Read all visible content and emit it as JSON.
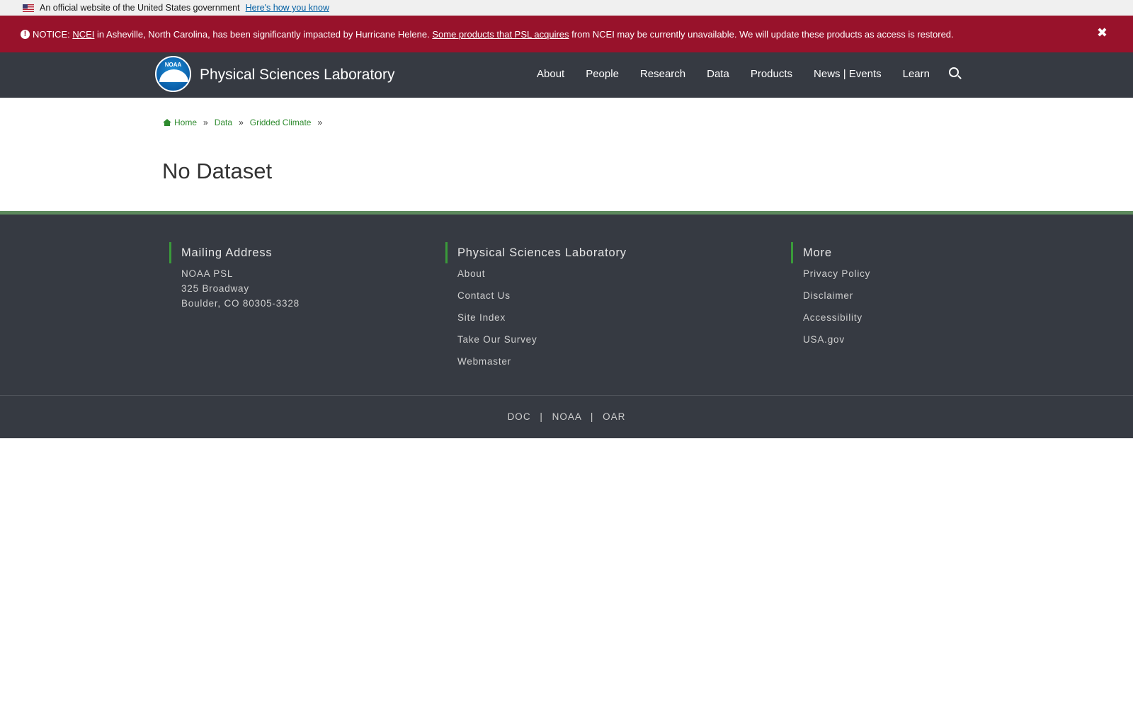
{
  "gov_banner": {
    "text": "An official website of the United States government",
    "link": "Here's how you know"
  },
  "notice": {
    "label": "NOTICE:",
    "ncei_link": "NCEI",
    "text1": " in Asheville, North Carolina, has been significantly impacted by Hurricane Helene. ",
    "products_link": "Some products that PSL acquires",
    "text2": " from NCEI may be currently unavailable. We will update these products as access is restored.",
    "close_glyph": "✖"
  },
  "header": {
    "logo_text": "NOAA",
    "site_title": "Physical Sciences Laboratory",
    "nav": [
      "About",
      "People",
      "Research",
      "Data",
      "Products",
      "News | Events",
      "Learn"
    ]
  },
  "breadcrumb": {
    "items": [
      "Home",
      "Data",
      "Gridded Climate"
    ],
    "separator": "»"
  },
  "page": {
    "title": "No Dataset"
  },
  "footer": {
    "mailing": {
      "heading": "Mailing Address",
      "lines": [
        "NOAA PSL",
        "325 Broadway",
        "Boulder, CO 80305-3328"
      ]
    },
    "psl": {
      "heading": "Physical Sciences Laboratory",
      "links": [
        "About",
        "Contact Us",
        "Site Index",
        "Take Our Survey",
        "Webmaster"
      ]
    },
    "more": {
      "heading": "More",
      "links": [
        "Privacy Policy",
        "Disclaimer",
        "Accessibility",
        "USA.gov"
      ]
    },
    "bottom_links": [
      "DOC",
      "NOAA",
      "OAR"
    ],
    "bottom_separator": "|"
  },
  "colors": {
    "notice_bg": "#98122b",
    "header_bg": "#363a42",
    "accent_green": "#2e8b2e",
    "footer_rule": "#5d8a5d"
  }
}
